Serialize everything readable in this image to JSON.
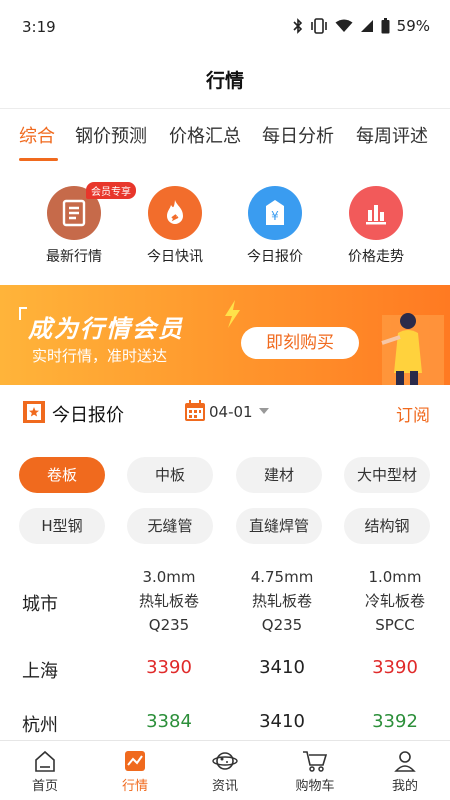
{
  "status_bar": {
    "time": "3:19",
    "battery": "59%",
    "icons": [
      "bluetooth-icon",
      "vibrate-icon",
      "wifi-icon",
      "signal-icon",
      "battery-icon"
    ]
  },
  "header": {
    "title": "行情"
  },
  "tabs": [
    {
      "label": "综合",
      "active": true
    },
    {
      "label": "钢价预测"
    },
    {
      "label": "价格汇总"
    },
    {
      "label": "每日分析"
    },
    {
      "label": "每周评述"
    }
  ],
  "quick_actions": {
    "badge": "会员专享",
    "items": [
      {
        "label": "最新行情",
        "icon": "document-icon",
        "color": "#c66a4a"
      },
      {
        "label": "今日快讯",
        "icon": "flame-icon",
        "color": "#f26d2c"
      },
      {
        "label": "今日报价",
        "icon": "price-tag-icon",
        "color": "#3a9cf0"
      },
      {
        "label": "价格走势",
        "icon": "bar-chart-icon",
        "color": "#f25a5a"
      }
    ]
  },
  "banner": {
    "title": "成为行情会员",
    "subtitle": "实时行情，准时送达",
    "cta": "即刻购买"
  },
  "price_section": {
    "title": "今日报价",
    "date": "04-01",
    "subscribe": "订阅"
  },
  "categories": [
    {
      "label": "卷板",
      "active": true
    },
    {
      "label": "中板"
    },
    {
      "label": "建材"
    },
    {
      "label": "大中型材"
    },
    {
      "label": "H型钢"
    },
    {
      "label": "无缝管"
    },
    {
      "label": "直缝焊管"
    },
    {
      "label": "结构钢"
    }
  ],
  "price_table": {
    "header_city": "城市",
    "columns": [
      {
        "spec": "3.0mm",
        "name": "热轧板卷",
        "grade": "Q235"
      },
      {
        "spec": "4.75mm",
        "name": "热轧板卷",
        "grade": "Q235"
      },
      {
        "spec": "1.0mm",
        "name": "冷轧板卷",
        "grade": "SPCC"
      }
    ],
    "rows": [
      {
        "city": "上海",
        "values": [
          "3390",
          "3410",
          "3390"
        ],
        "trend": [
          "up",
          "flat",
          "up"
        ]
      },
      {
        "city": "杭州",
        "values": [
          "3384",
          "3410",
          "3392"
        ],
        "trend": [
          "down",
          "flat",
          "down"
        ]
      }
    ]
  },
  "colors": {
    "accent": "#f06a1e",
    "up": "#e02a2a",
    "down": "#2c8f3a"
  },
  "bottom_nav": [
    {
      "label": "首页",
      "icon": "home-icon"
    },
    {
      "label": "行情",
      "icon": "market-chart-icon",
      "active": true
    },
    {
      "label": "资讯",
      "icon": "planet-icon"
    },
    {
      "label": "购物车",
      "icon": "cart-icon"
    },
    {
      "label": "我的",
      "icon": "user-icon"
    }
  ]
}
